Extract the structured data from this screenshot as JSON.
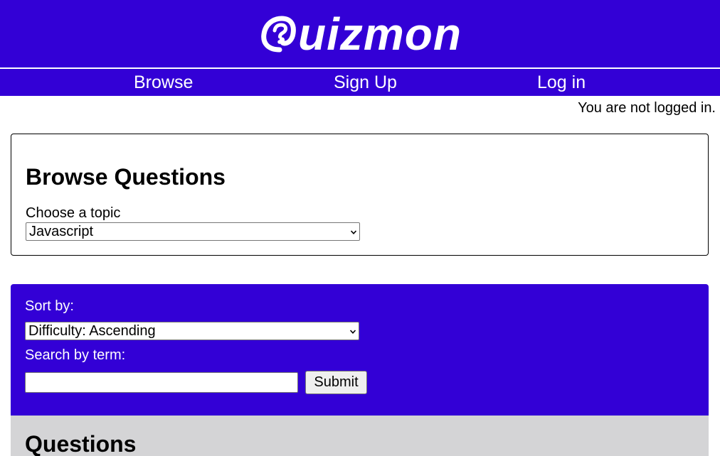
{
  "header": {
    "logo_text": "uizmon",
    "logo_mark_icon": "question-at-icon",
    "brand_color": "#3300d6"
  },
  "nav": {
    "items": [
      {
        "label": "Browse"
      },
      {
        "label": "Sign Up"
      },
      {
        "label": "Log in"
      }
    ]
  },
  "status": {
    "login_text": "You are not logged in."
  },
  "browse": {
    "title": "Browse Questions",
    "topic_label": "Choose a topic",
    "topic_selected": "Javascript"
  },
  "filters": {
    "sort_label": "Sort by:",
    "sort_selected": "Difficulty: Ascending",
    "search_label": "Search by term:",
    "search_value": "",
    "submit_label": "Submit"
  },
  "questions": {
    "title": "Questions",
    "panel_color": "#d4d4d6"
  }
}
